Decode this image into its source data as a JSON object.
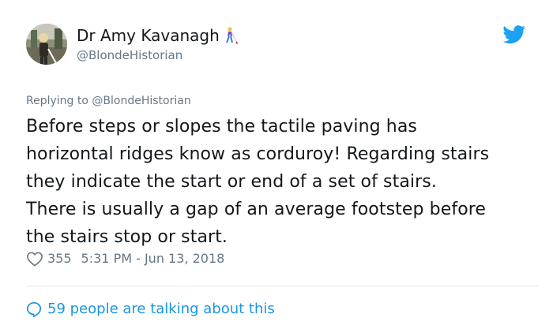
{
  "author": {
    "display_name": "Dr Amy Kavanagh",
    "handle": "@BlondeHistorian"
  },
  "icons": {
    "avatar": "avatar-photo",
    "name_emoji": "person-with-probing-cane-icon",
    "platform": "twitter-bird-icon",
    "like": "heart-outline-icon",
    "reply_count": "speech-bubble-icon"
  },
  "colors": {
    "brand": "#1da1f2",
    "link": "#1b95e0",
    "muted": "#657786",
    "text": "#14171a"
  },
  "reply": {
    "prefix": "Replying to",
    "handle": "@BlondeHistorian"
  },
  "tweet": {
    "lines": [
      "Before steps or slopes the tactile paving has",
      "horizontal ridges know as corduroy! Regarding stairs",
      "they indicate the start or end of a set of stairs.",
      "There is usually a gap of an average footstep before",
      "the stairs stop or start."
    ]
  },
  "meta": {
    "likes": "355",
    "timestamp": "5:31 PM - Jun 13, 2018"
  },
  "footer": {
    "talking_text": "59 people are talking about this"
  }
}
